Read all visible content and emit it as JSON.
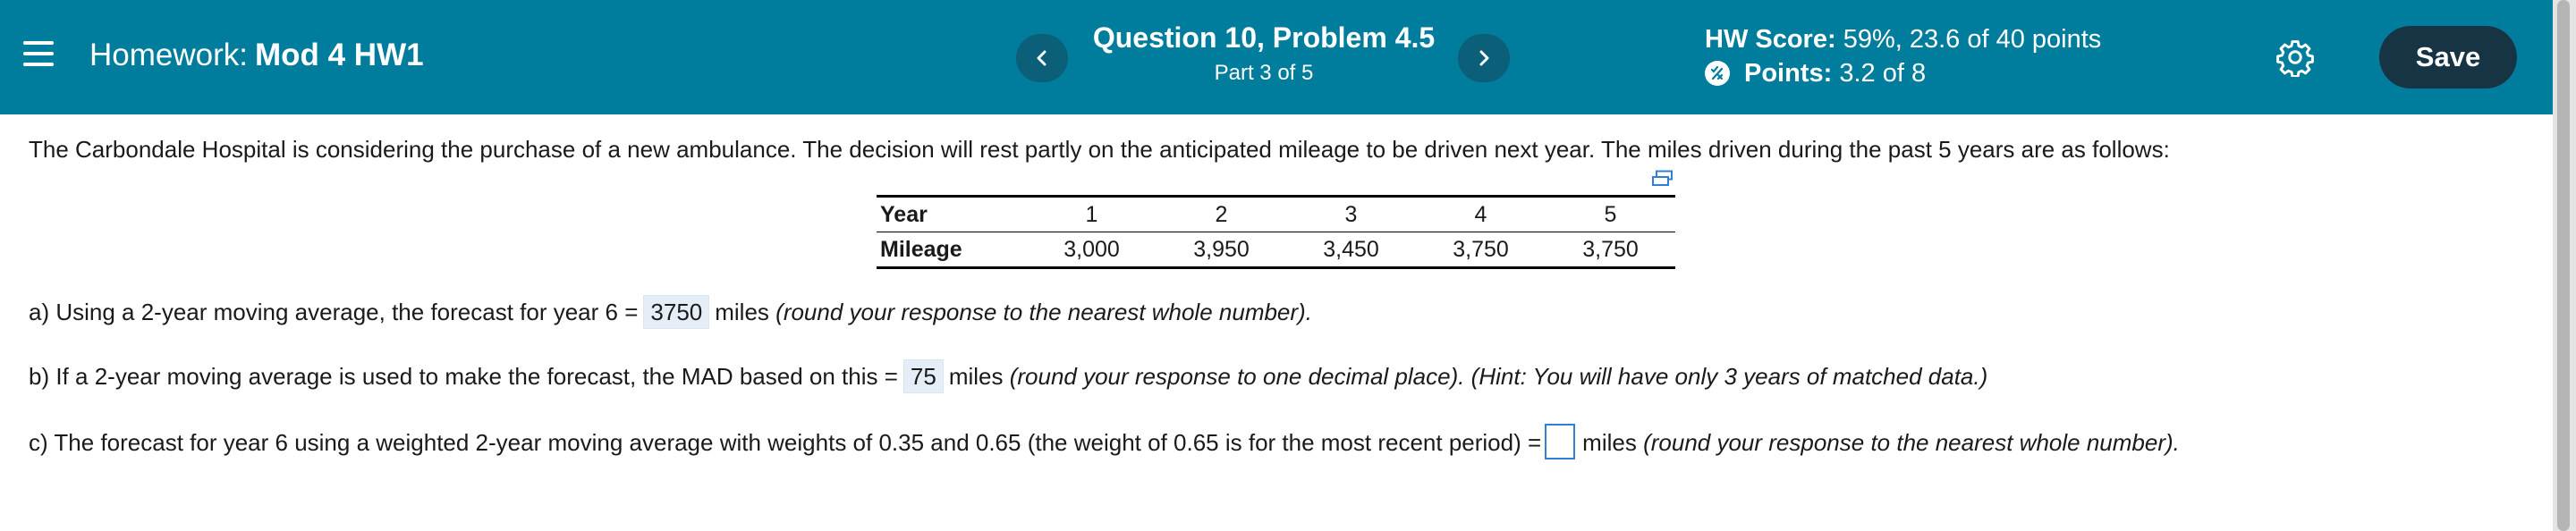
{
  "header": {
    "homework_label": "Homework:",
    "homework_name": "Mod 4 HW1",
    "question_title": "Question 10, Problem 4.5",
    "question_part": "Part 3 of 5",
    "hw_score_label": "HW Score:",
    "hw_score_value": "59%, 23.6 of 40 points",
    "points_label": "Points:",
    "points_value": "3.2 of 8",
    "save_label": "Save",
    "icons": [
      "menu-icon",
      "chevron-left-icon",
      "chevron-right-icon",
      "partial-credit-icon",
      "gear-icon"
    ],
    "colors": {
      "bar": "#007d9c",
      "nav_button": "#0b5f79",
      "save_button": "#163444"
    }
  },
  "problem": {
    "intro": "The Carbondale Hospital is considering the purchase of a new ambulance. The decision will rest partly on the anticipated mileage to be driven next year. The miles driven during the past 5 years are as follows:",
    "table": {
      "row_labels": [
        "Year",
        "Mileage"
      ],
      "years": [
        "1",
        "2",
        "3",
        "4",
        "5"
      ],
      "mileage": [
        "3,000",
        "3,950",
        "3,450",
        "3,750",
        "3,750"
      ]
    },
    "part_a": {
      "prefix": "a) Using a 2-year moving average, the forecast for year 6 =",
      "answer": "3750",
      "unit": "miles",
      "note": "(round your response to the nearest whole number)."
    },
    "part_b": {
      "prefix": "b) If a 2-year moving average is used to make the forecast, the MAD based on this =",
      "answer": "75",
      "unit": "miles",
      "note": "(round your response to one decimal place).  (Hint: You will have only 3 years of matched data.)"
    },
    "part_c": {
      "prefix": "c) The forecast for year 6 using a weighted 2-year moving average with weights of 0.35 and 0.65 (the weight of 0.65 is for the most recent period) =",
      "answer": "",
      "unit": "miles",
      "note": "(round your response to the nearest whole number)."
    }
  }
}
